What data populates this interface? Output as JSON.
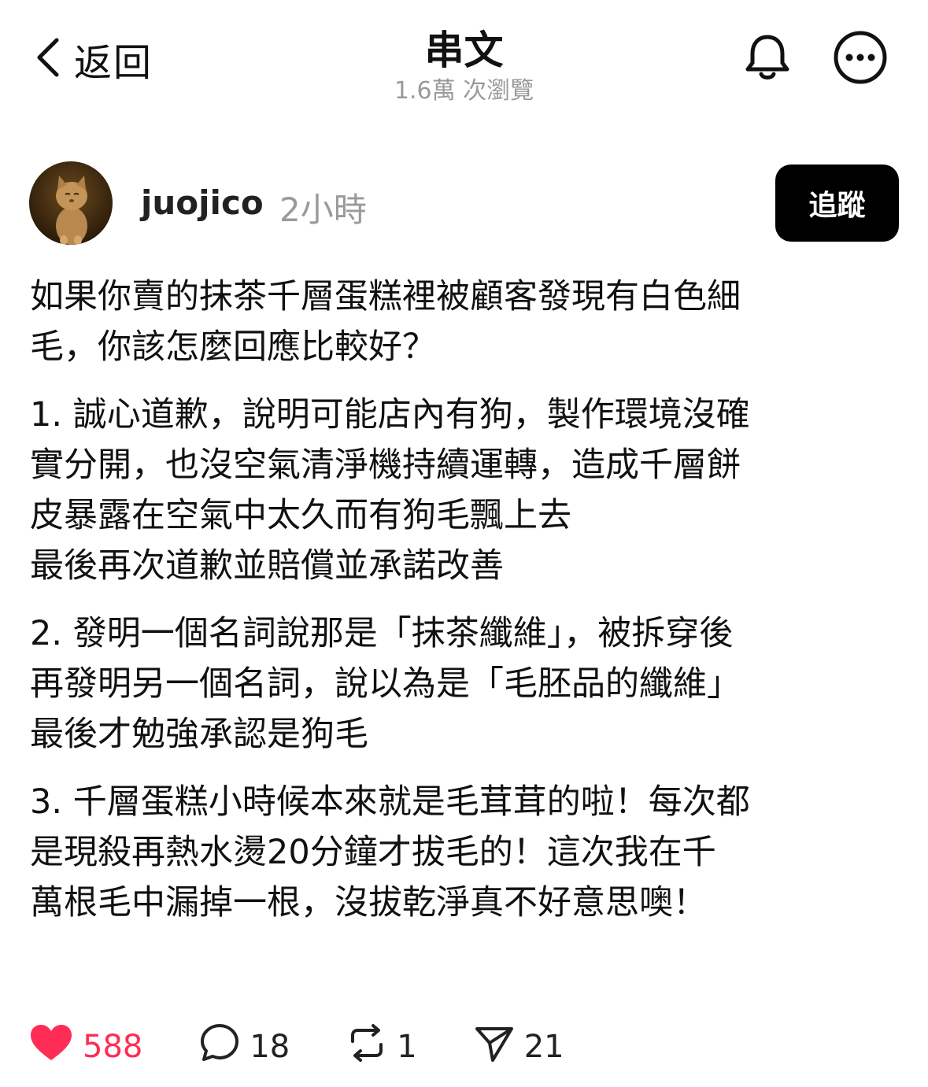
{
  "header": {
    "back_label": "返回",
    "title": "串文",
    "views": "1.6萬 次瀏覽",
    "icons": [
      "chevron-left-icon",
      "bell-icon",
      "more-icon"
    ]
  },
  "author": {
    "username": "juojico",
    "time": "2小時",
    "follow_label": "追蹤"
  },
  "post": {
    "paragraphs": [
      "如果你賣的抹茶千層蛋糕裡被顧客發現有白色細\n毛，你該怎麼回應比較好？",
      "1. 誠心道歉，說明可能店內有狗，製作環境沒確\n實分開，也沒空氣清淨機持續運轉，造成千層餅\n皮暴露在空氣中太久而有狗毛飄上去\n最後再次道歉並賠償並承諾改善",
      "2. 發明一個名詞說那是「抹茶纖維」，被拆穿後\n再發明另一個名詞，說以為是「毛胚品的纖維」\n最後才勉強承認是狗毛",
      "3. 千層蛋糕小時候本來就是毛茸茸的啦！每次都\n是現殺再熱水燙20分鐘才拔毛的！這次我在千\n萬根毛中漏掉一根，沒拔乾淨真不好意思噢！"
    ]
  },
  "actions": {
    "likes": "588",
    "comments": "18",
    "reposts": "1",
    "shares": "21"
  },
  "colors": {
    "like": "#ff2d55",
    "secondary_text": "#9a9a9a",
    "follow_bg": "#000000"
  }
}
